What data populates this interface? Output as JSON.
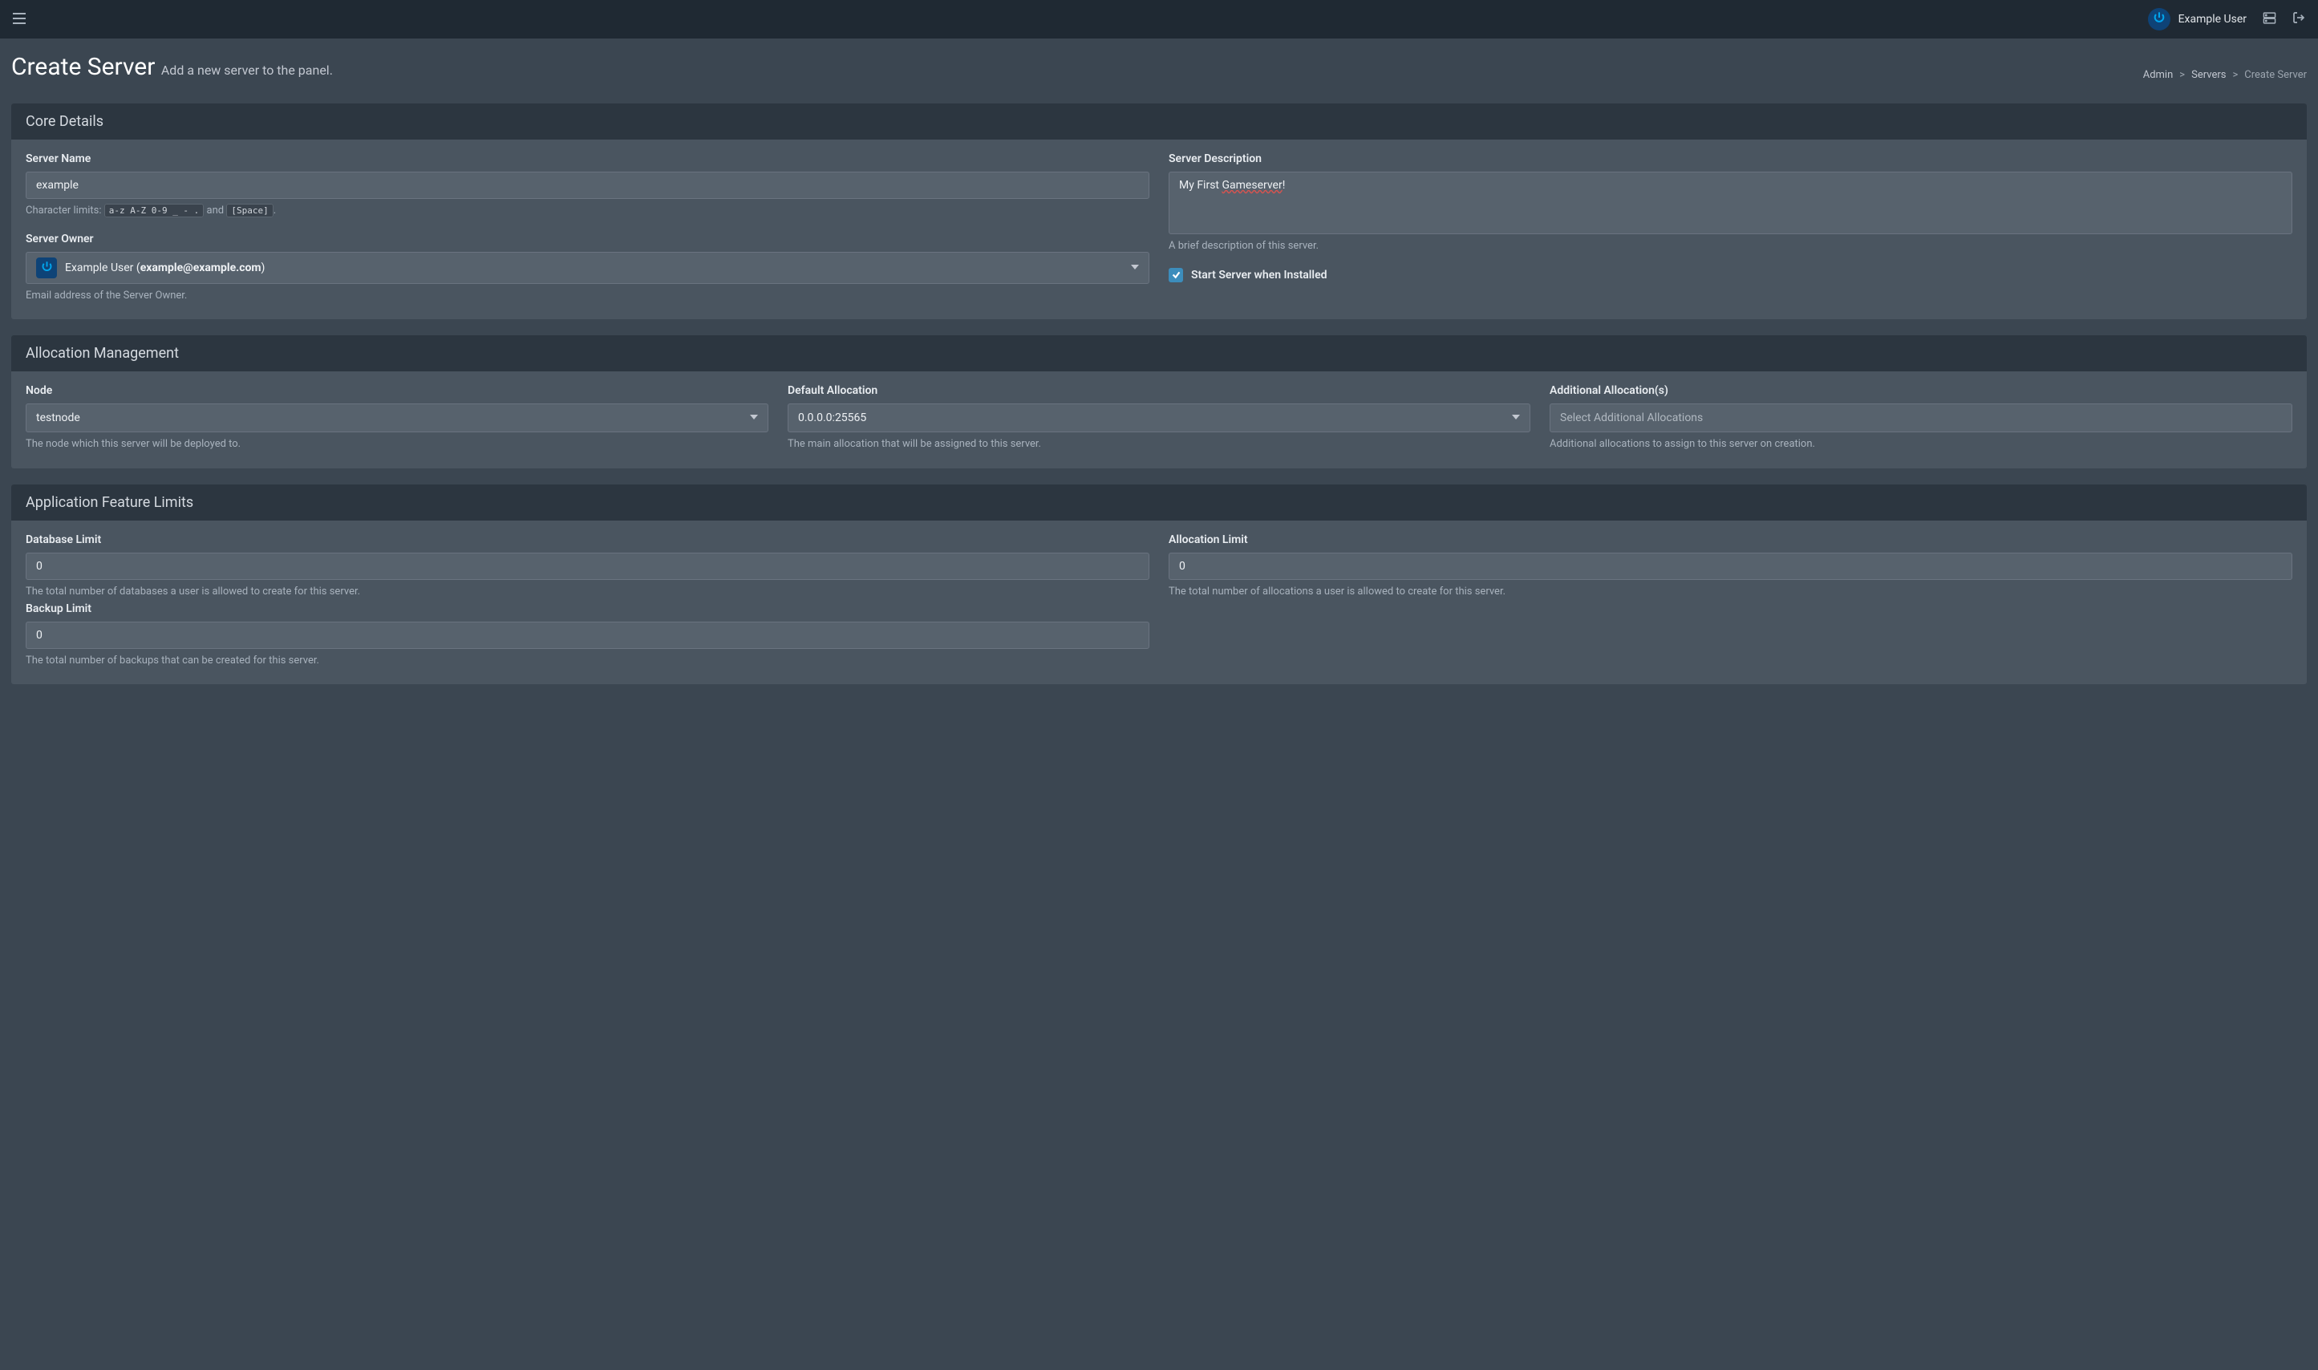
{
  "navbar": {
    "user_name": "Example User"
  },
  "header": {
    "title": "Create Server",
    "subtitle": "Add a new server to the panel."
  },
  "breadcrumb": {
    "admin": "Admin",
    "servers": "Servers",
    "current": "Create Server",
    "sep": ">"
  },
  "core_details": {
    "title": "Core Details",
    "server_name_label": "Server Name",
    "server_name_value": "example",
    "char_limits_prefix": "Character limits: ",
    "char_limits_code1": "a-z A-Z 0-9 _ - .",
    "char_limits_and": " and ",
    "char_limits_code2": "[Space]",
    "char_limits_suffix": ".",
    "server_owner_label": "Server Owner",
    "owner_name": "Example User (",
    "owner_email": "example@example.com",
    "owner_suffix": ")",
    "owner_help": "Email address of the Server Owner.",
    "server_desc_label": "Server Description",
    "server_desc_prefix": "My First ",
    "server_desc_misspell": "Gameserver",
    "server_desc_suffix": "!",
    "server_desc_help": "A brief description of this server.",
    "start_checkbox_label": "Start Server when Installed"
  },
  "allocation": {
    "title": "Allocation Management",
    "node_label": "Node",
    "node_value": "testnode",
    "node_help": "The node which this server will be deployed to.",
    "default_alloc_label": "Default Allocation",
    "default_alloc_value": "0.0.0.0:25565",
    "default_alloc_help": "The main allocation that will be assigned to this server.",
    "additional_label": "Additional Allocation(s)",
    "additional_placeholder": "Select Additional Allocations",
    "additional_help": "Additional allocations to assign to this server on creation."
  },
  "feature_limits": {
    "title": "Application Feature Limits",
    "db_label": "Database Limit",
    "db_value": "0",
    "db_help": "The total number of databases a user is allowed to create for this server.",
    "alloc_label": "Allocation Limit",
    "alloc_value": "0",
    "alloc_help": "The total number of allocations a user is allowed to create for this server.",
    "backup_label": "Backup Limit",
    "backup_value": "0",
    "backup_help": "The total number of backups that can be created for this server."
  }
}
